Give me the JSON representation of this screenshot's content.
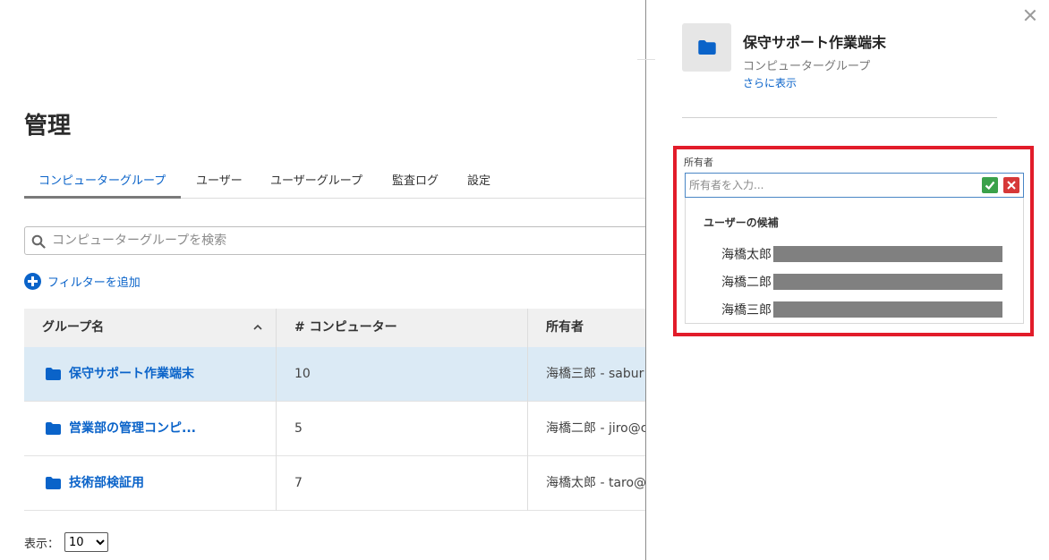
{
  "main": {
    "title": "管理",
    "tabs": [
      {
        "label": "コンピューターグループ",
        "active": true
      },
      {
        "label": "ユーザー",
        "active": false
      },
      {
        "label": "ユーザーグループ",
        "active": false
      },
      {
        "label": "監査ログ",
        "active": false
      },
      {
        "label": "設定",
        "active": false
      }
    ],
    "search": {
      "placeholder": "コンピューターグループを検索",
      "value": ""
    },
    "add_filter_label": "フィルターを追加",
    "table": {
      "columns": [
        "グループ名",
        "# コンピューター",
        "所有者"
      ],
      "sort_icon": "chevron-up-icon",
      "rows": [
        {
          "name": "保守サポート作業端末",
          "count": "10",
          "owner": "海橋三郎 - sabur",
          "selected": true
        },
        {
          "name": "営業部の管理コンピ...",
          "count": "5",
          "owner": "海橋二郎 - jiro@c",
          "selected": false
        },
        {
          "name": "技術部検証用",
          "count": "7",
          "owner": "海橋太郎 - taro@",
          "selected": false
        }
      ]
    },
    "pagesize": {
      "label": "表示：",
      "value": "10",
      "options": [
        "10"
      ]
    }
  },
  "panel": {
    "title": "保守サポート作業端末",
    "subtitle": "コンピューターグループ",
    "more_link": "さらに表示",
    "owner_field": {
      "label": "所有者",
      "placeholder": "所有者を入力...",
      "value": "",
      "suggestions_header": "ユーザーの候補",
      "suggestions": [
        {
          "name": "海橋太郎"
        },
        {
          "name": "海橋二郎"
        },
        {
          "name": "海橋三郎"
        }
      ]
    }
  },
  "colors": {
    "accent": "#0a63c9",
    "highlight_border": "#e21c2a",
    "selected_row": "#dbeaf5",
    "confirm": "#3aa14a",
    "cancel": "#d63838"
  }
}
